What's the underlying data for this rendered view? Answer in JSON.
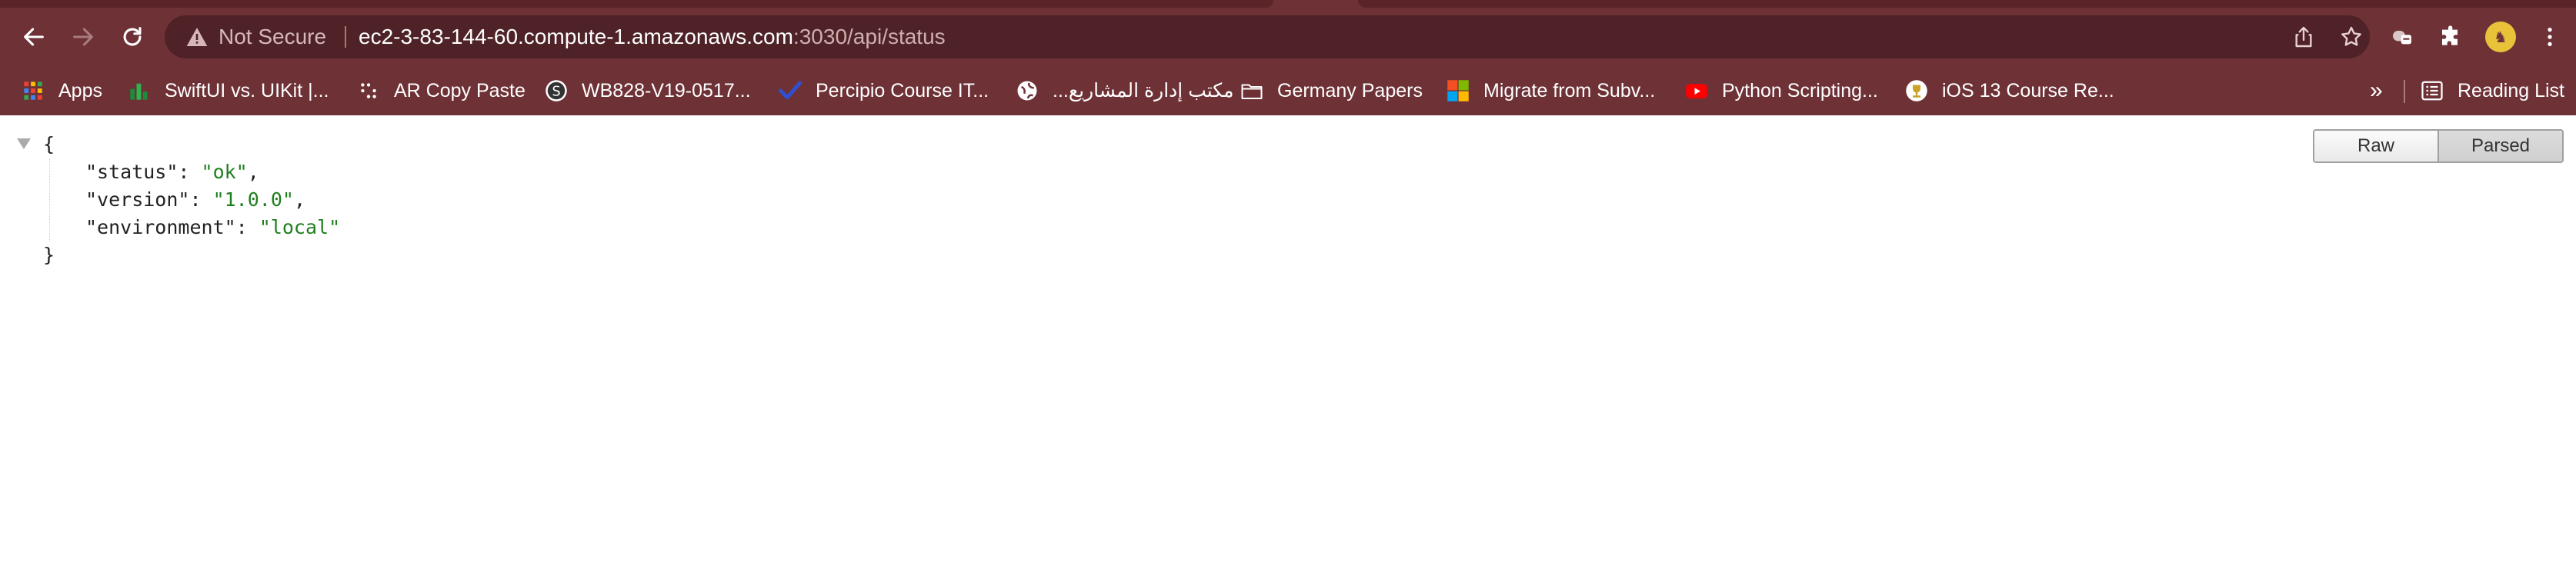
{
  "browser": {
    "security_label": "Not Secure",
    "url_host": "ec2-3-83-144-60.compute-1.amazonaws.com",
    "url_rest": ":3030/api/status",
    "reading_list_label": "Reading List",
    "colors": {
      "frame": "#6e3136",
      "omnibox": "#4e2226"
    }
  },
  "bookmarks": [
    {
      "label": "Apps",
      "icon": "apps-grid-icon"
    },
    {
      "label": "SwiftUI vs. UIKit |...",
      "icon": "green-bars-icon"
    },
    {
      "label": "AR Copy Paste",
      "icon": "dots-icon"
    },
    {
      "label": "WB828-V19-0517...",
      "icon": "s-logo-icon"
    },
    {
      "label": "Percipio Course IT...",
      "icon": "check-logo-icon"
    },
    {
      "label": "مكتب إدارة المشاريع...",
      "icon": "globe-icon"
    },
    {
      "label": "Germany Papers",
      "icon": "folder-icon"
    },
    {
      "label": "Migrate from Subv...",
      "icon": "microsoft-logo-icon"
    },
    {
      "label": "Python Scripting...",
      "icon": "youtube-icon"
    },
    {
      "label": "iOS 13 Course Re...",
      "icon": "trophy-icon"
    }
  ],
  "bookmarks_overflow": "»",
  "viewer": {
    "raw_label": "Raw",
    "parsed_label": "Parsed",
    "active": "Parsed"
  },
  "json": {
    "open_brace": "{",
    "close_brace": "}",
    "entries": [
      {
        "key": "\"status\"",
        "value": "\"ok\"",
        "sep": ","
      },
      {
        "key": "\"version\"",
        "value": "\"1.0.0\"",
        "sep": ","
      },
      {
        "key": "\"environment\"",
        "value": "\"local\"",
        "sep": ""
      }
    ]
  }
}
